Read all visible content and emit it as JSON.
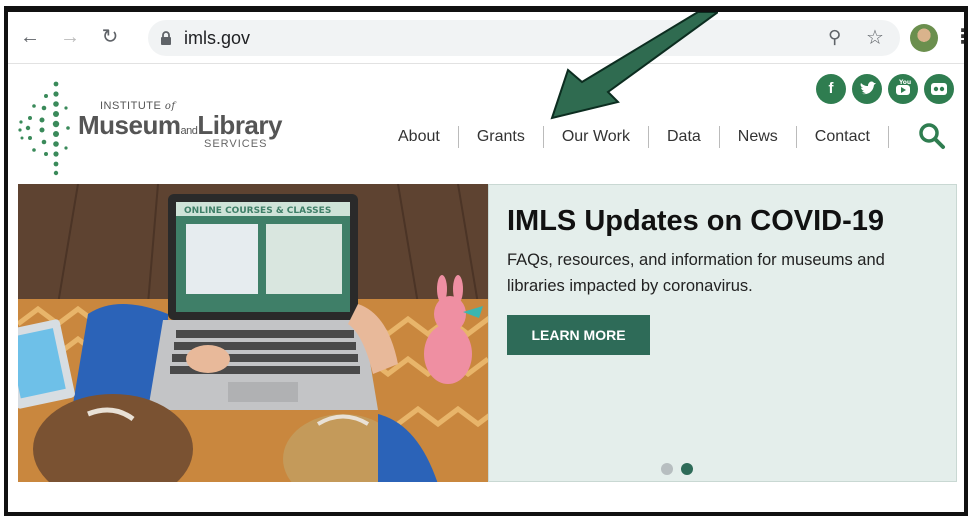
{
  "browser": {
    "url": "imls.gov",
    "icons": [
      "back-arrow",
      "forward-arrow",
      "reload",
      "lock",
      "zoom",
      "star",
      "profile",
      "kebab-menu"
    ]
  },
  "site": {
    "logo": {
      "institute": "INSTITUTE",
      "of": "of",
      "museum": "Museum",
      "and": "and",
      "library": "Library",
      "services": "SERVICES"
    },
    "social": [
      {
        "name": "facebook",
        "glyph": "f"
      },
      {
        "name": "twitter",
        "glyph": "t"
      },
      {
        "name": "youtube",
        "glyph": "▶"
      },
      {
        "name": "flickr",
        "glyph": "••"
      }
    ],
    "nav": [
      "About",
      "Grants",
      "Our Work",
      "Data",
      "News",
      "Contact"
    ]
  },
  "hero": {
    "title": "IMLS Updates on COVID-19",
    "description": "FAQs, resources, and information for museums and libraries impacted by coronavirus.",
    "button": "LEARN MORE",
    "laptop_screen_text": "ONLINE COURSES & CLASSES",
    "carousel": {
      "slides": 2,
      "active": 2
    }
  },
  "colors": {
    "brand_green": "#2f7d50",
    "button_green": "#2e6b58",
    "panel_bg": "#e4eeeb",
    "arrow_green": "#2f6b50"
  }
}
